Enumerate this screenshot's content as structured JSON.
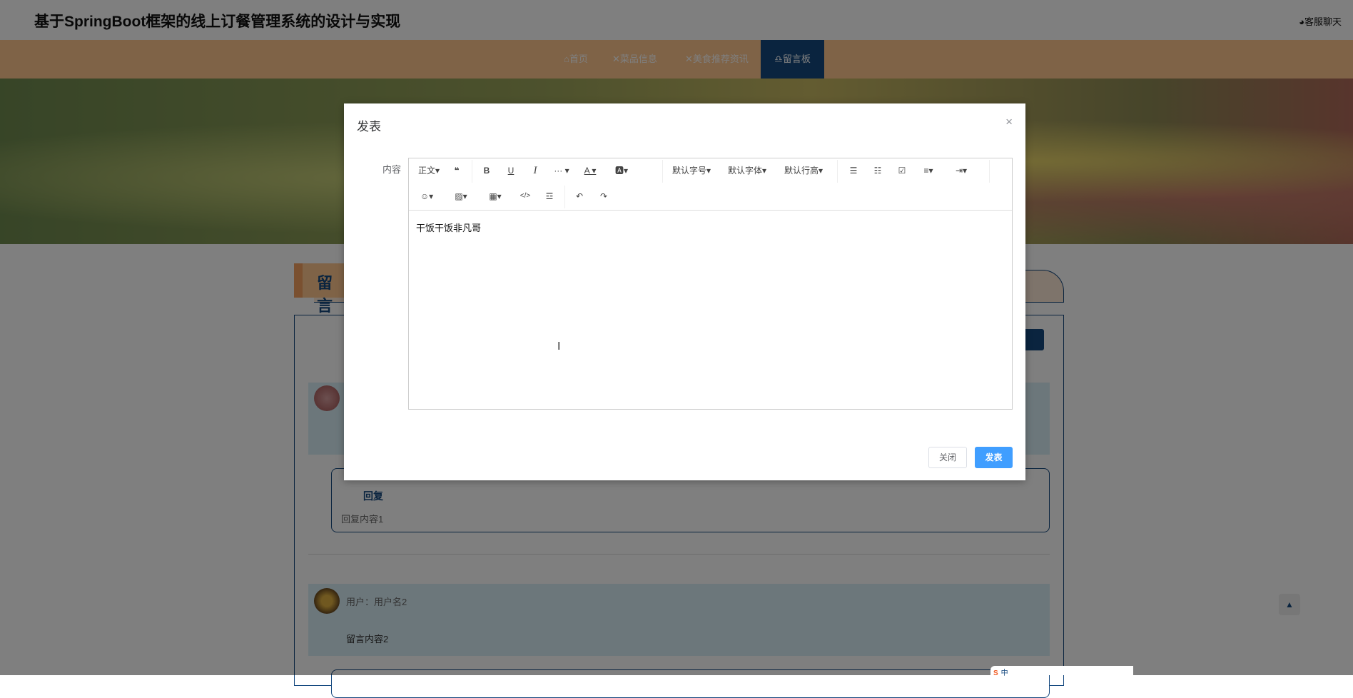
{
  "header": {
    "title": "基于SpringBoot框架的线上订餐管理系统的设计与实现",
    "chat": "客服聊天",
    "user": "1"
  },
  "nav": [
    {
      "icon": "home-icon",
      "label": "首页"
    },
    {
      "icon": "utensils-icon",
      "label": "菜品信息"
    },
    {
      "icon": "utensils-icon",
      "label": "美食推荐资讯"
    },
    {
      "icon": "headset-icon",
      "label": "留言板",
      "active": true
    }
  ],
  "section": {
    "title": "留言"
  },
  "messages": [
    {
      "user": "",
      "content": "",
      "reply_title": "回复",
      "reply": "回复内容1"
    },
    {
      "user": "用户：用户名2",
      "content": "留言内容2"
    }
  ],
  "dialog": {
    "title": "发表",
    "label": "内容",
    "content": "干饭干饭非凡哥",
    "close_label": "关闭",
    "submit_label": "发表",
    "toolbar": {
      "paragraph": "正文",
      "font_size": "默认字号",
      "font_family": "默认字体",
      "line_height": "默认行高"
    }
  },
  "ime": {
    "label": "中"
  },
  "colors": {
    "accent": "#14487f",
    "nav": "#fec68e",
    "primary": "#409eff"
  }
}
